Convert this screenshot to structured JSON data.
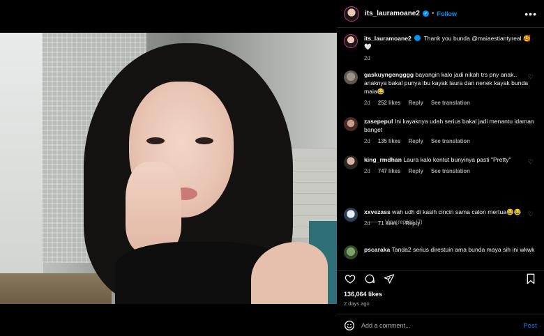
{
  "post": {
    "username": "its_lauramoane2",
    "follow_label": "Follow",
    "separator": "•",
    "more_label": "•••",
    "caption": {
      "username": "its_lauramoane2",
      "text": "Thank you bunda @maiaestiantyreal 🥰🤍",
      "time": "2d"
    },
    "likes": "136,064 likes",
    "time_ago": "2 days ago"
  },
  "comments": [
    {
      "username": "gaskuyngengggg",
      "text": "bayangin kalo jadi nikah trs pny anak.. anaknya bakal punya ibu kayak laura dan nenek kayak bunda maia😂",
      "time": "2d",
      "likes": "252 likes",
      "reply": "Reply",
      "see_translation": "See translation"
    },
    {
      "username": "zasepepul",
      "text": "Ini kayaknya udah serius bakal jadi menantu idaman banget",
      "time": "2d",
      "likes": "135 likes",
      "reply": "Reply",
      "see_translation": "See translation"
    },
    {
      "username": "king_rmdhan",
      "text": "Laura kalo kentut bunyinya pasti \"Pretty\"",
      "time": "2d",
      "likes": "747 likes",
      "reply": "Reply",
      "see_translation": "See translation",
      "view_replies": "View replies (7)"
    },
    {
      "username": "xxvezass",
      "text": "wah udh di kasih cincin sama calon mertua😂😂",
      "time": "2d",
      "likes": "71 likes",
      "reply": "Reply"
    },
    {
      "username": "pscaraka",
      "text": "Tanda2 serius direstuin ama bunda maya sih ini wkwk",
      "time": "",
      "likes": "",
      "reply": ""
    }
  ],
  "comment_box": {
    "placeholder": "Add a comment...",
    "post_label": "Post"
  },
  "icons": {
    "heart": "♡"
  },
  "colors": {
    "accent": "#0095f6",
    "background": "#000000",
    "secondary_text": "#a8a8a8"
  }
}
